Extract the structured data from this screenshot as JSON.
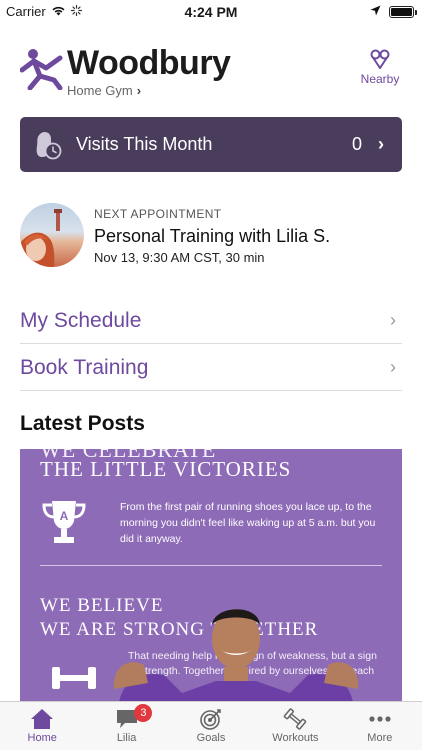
{
  "status_bar": {
    "carrier": "Carrier",
    "time": "4:24 PM",
    "icons": [
      "wifi-icon",
      "activity-spinner-icon",
      "location-arrow-icon",
      "battery-icon"
    ]
  },
  "header": {
    "gym_name": "Woodbury",
    "home_gym_label": "Home Gym",
    "home_gym_chevron": "›",
    "nearby_label": "Nearby",
    "brand_color": "#6e4a9e"
  },
  "visits": {
    "label": "Visits This Month",
    "count": "0",
    "chevron": "›",
    "background": "#4a3d5c"
  },
  "appointment": {
    "kicker": "NEXT APPOINTMENT",
    "title": "Personal Training with Lilia S.",
    "time": "Nov 13, 9:30 AM CST, 30 min"
  },
  "menu": [
    {
      "label": "My Schedule",
      "chevron": "›"
    },
    {
      "label": "Book Training",
      "chevron": "›"
    }
  ],
  "latest_posts": {
    "title": "Latest Posts",
    "post": {
      "cut_heading": "WE CELEBRATE",
      "heading_1": "THE LITTLE VICTORIES",
      "body_1": "From the first pair of running shoes you lace up, to the morning you didn't feel like waking up at 5 a.m. but you did it anyway.",
      "heading_2": "WE BELIEVE",
      "heading_3": "WE ARE STRONG TOGETHER",
      "body_2": "That needing help isn't a sign of weakness, but a sign of strength. Together, inspired by ourselves and each other.",
      "background": "#8e6bb7"
    }
  },
  "tab_bar": {
    "tabs": [
      {
        "label": "Home",
        "icon": "home-icon",
        "active": true
      },
      {
        "label": "Lilia",
        "icon": "chat-bubble-icon",
        "badge": "3"
      },
      {
        "label": "Goals",
        "icon": "target-icon"
      },
      {
        "label": "Workouts",
        "icon": "dumbbell-icon"
      },
      {
        "label": "More",
        "icon": "more-dots-icon"
      }
    ]
  }
}
